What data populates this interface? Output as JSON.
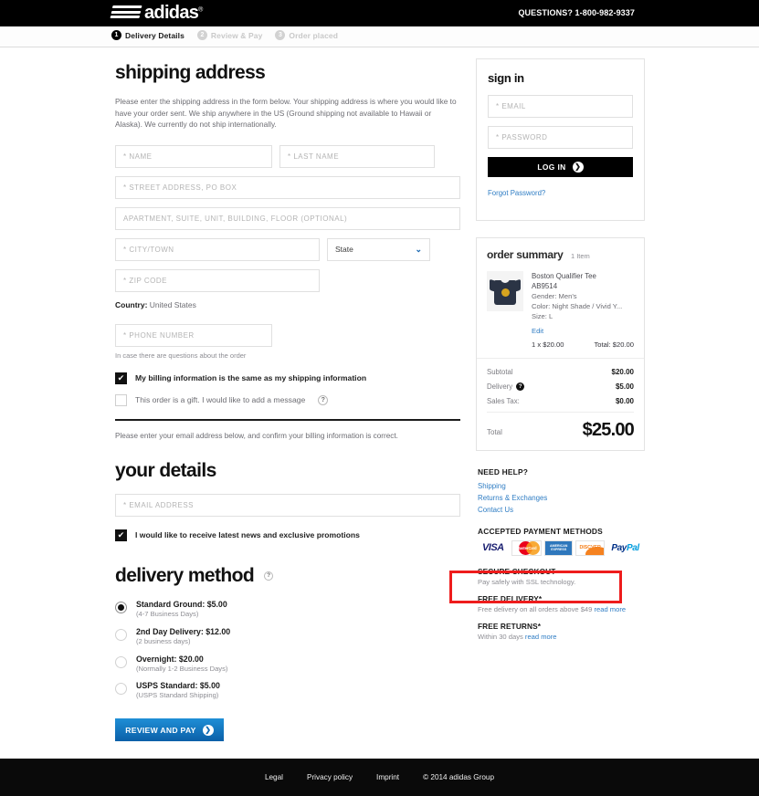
{
  "header": {
    "brand": "adidas",
    "questions": "QUESTIONS? 1-800-982-9337",
    "steps": [
      {
        "num": "1",
        "label": "Delivery Details",
        "state": "active"
      },
      {
        "num": "2",
        "label": "Review & Pay",
        "state": "inactive"
      },
      {
        "num": "3",
        "label": "Order placed",
        "state": "inactive"
      }
    ]
  },
  "shipping": {
    "title": "shipping address",
    "intro": "Please enter the shipping address in the form below. Your shipping address is where you would like to have your order sent. We ship anywhere in the US (Ground shipping not available to Hawaii or Alaska). We currently do not ship internationally.",
    "fields": {
      "name": "* NAME",
      "last_name": "* LAST NAME",
      "street": "* STREET ADDRESS, PO BOX",
      "apartment": "APARTMENT, SUITE, UNIT, BUILDING, FLOOR (OPTIONAL)",
      "city": "* CITY/TOWN",
      "state": "State",
      "zip": "* ZIP CODE",
      "phone": "* PHONE NUMBER"
    },
    "values": {
      "name": "",
      "last_name": "",
      "street": "",
      "apartment": "",
      "city": "",
      "zip": "",
      "phone": ""
    },
    "country_label": "Country:",
    "country_value": "United States",
    "phone_hint": "In case there are questions about the order",
    "billing_same_label": "My billing information is the same as my shipping information",
    "billing_same_checked": true,
    "gift_label": "This order is a gift. I would like to add a message",
    "gift_checked": false,
    "help_glyph": "?",
    "billing_note": "Please enter your email address below, and confirm your billing information is correct."
  },
  "your_details": {
    "title": "your details",
    "email_placeholder": "* EMAIL ADDRESS",
    "email_value": "",
    "promo_label": "I would like to receive latest news and exclusive promotions",
    "promo_checked": true
  },
  "delivery": {
    "title": "delivery method",
    "help_glyph": "?",
    "options": [
      {
        "label": "Standard Ground: $5.00",
        "sub": "(4-7 Business Days)",
        "selected": true
      },
      {
        "label": "2nd Day Delivery: $12.00",
        "sub": "(2 business days)",
        "selected": false
      },
      {
        "label": "Overnight: $20.00",
        "sub": "(Normally 1-2 Business Days)",
        "selected": false
      },
      {
        "label": "USPS Standard: $5.00",
        "sub": "(USPS Standard Shipping)",
        "selected": false
      }
    ],
    "submit_label": "REVIEW AND PAY",
    "submit_arrow": "❯"
  },
  "signin": {
    "title": "sign in",
    "email_placeholder": "* EMAIL",
    "email_value": "",
    "password_placeholder": "* PASSWORD",
    "password_value": "",
    "login_label": "LOG IN",
    "login_arrow": "❯",
    "forgot_label": "Forgot Password?"
  },
  "order_summary": {
    "title": "order summary",
    "item_count": "1 Item",
    "product": {
      "name": "Boston Qualifier Tee",
      "sku": "AB9514",
      "gender": "Gender: Men's",
      "color": "Color: Night Shade / Vivid Y...",
      "size": "Size: L",
      "edit_label": "Edit",
      "qty_price": "1 x $20.00",
      "line_total": "Total: $20.00"
    },
    "totals": [
      {
        "label": "Subtotal",
        "value": "$20.00",
        "has_help": false
      },
      {
        "label": "Delivery",
        "value": "$5.00",
        "has_help": true
      },
      {
        "label": "Sales Tax:",
        "value": "$0.00",
        "has_help": false
      }
    ],
    "grand_label": "Total",
    "grand_value": "$25.00",
    "help_glyph": "?"
  },
  "help": {
    "title": "NEED HELP?",
    "links": [
      "Shipping",
      "Returns & Exchanges",
      "Contact Us"
    ],
    "payment_title": "ACCEPTED PAYMENT METHODS",
    "cards": [
      {
        "name": "visa-logo",
        "text": "VISA"
      },
      {
        "name": "mastercard-logo",
        "text": "MasterCard"
      },
      {
        "name": "amex-logo",
        "text": "AMERICAN EXPRESS"
      },
      {
        "name": "discover-logo",
        "text": "DISC",
        "accent": "VER"
      },
      {
        "name": "paypal-logo",
        "text": "Pay",
        "accent": "Pal"
      }
    ]
  },
  "trust": [
    {
      "title": "SECURE CHECKOUT",
      "sub": "Pay safely with SSL technology.",
      "link": "",
      "highlighted": true
    },
    {
      "title": "FREE DELIVERY*",
      "sub": "Free delivery on all orders above $49 ",
      "link": "read more",
      "highlighted": false
    },
    {
      "title": "FREE RETURNS*",
      "sub": "Within 30 days ",
      "link": "read more",
      "highlighted": false
    }
  ],
  "footer": {
    "links": [
      "Legal",
      "Privacy policy",
      "Imprint"
    ],
    "copyright": "© 2014 adidas Group"
  },
  "annotation": {
    "color": "#ee1c1c"
  }
}
